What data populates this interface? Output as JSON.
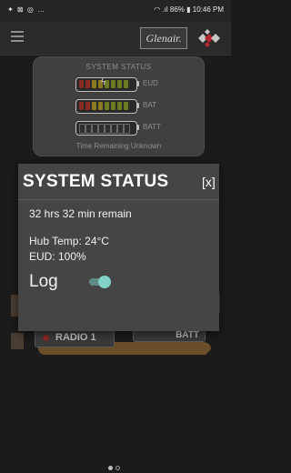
{
  "status_bar": {
    "left_icons": "✦ ⊠ ◎ …",
    "right_text": "86% ▮ 10:46 PM"
  },
  "app_bar": {
    "logo_text": "Glenair."
  },
  "background_panel": {
    "title": "SYSTEM STATUS",
    "batteries": [
      {
        "label": "EUD"
      },
      {
        "label": "BAT"
      },
      {
        "label": "BATT"
      }
    ],
    "time_remaining": "Time Remaining Unknown"
  },
  "background_device": {
    "radio_label": "RADIO 1",
    "batt_label": "BATT"
  },
  "modal": {
    "title": "SYSTEM STATUS",
    "close_label": "[x]",
    "remaining_text": "32 hrs 32 min remain",
    "hub_temp_text": "Hub Temp: 24°C",
    "eud_text": "EUD: 100%",
    "log_label": "Log",
    "log_enabled": true
  },
  "colors": {
    "accent": "#82d2c7",
    "battery_red": "#c0392b",
    "battery_yellow": "#c9a227",
    "battery_green": "#8a9a2a"
  },
  "page_indicator": {
    "current": 1,
    "total": 2
  }
}
